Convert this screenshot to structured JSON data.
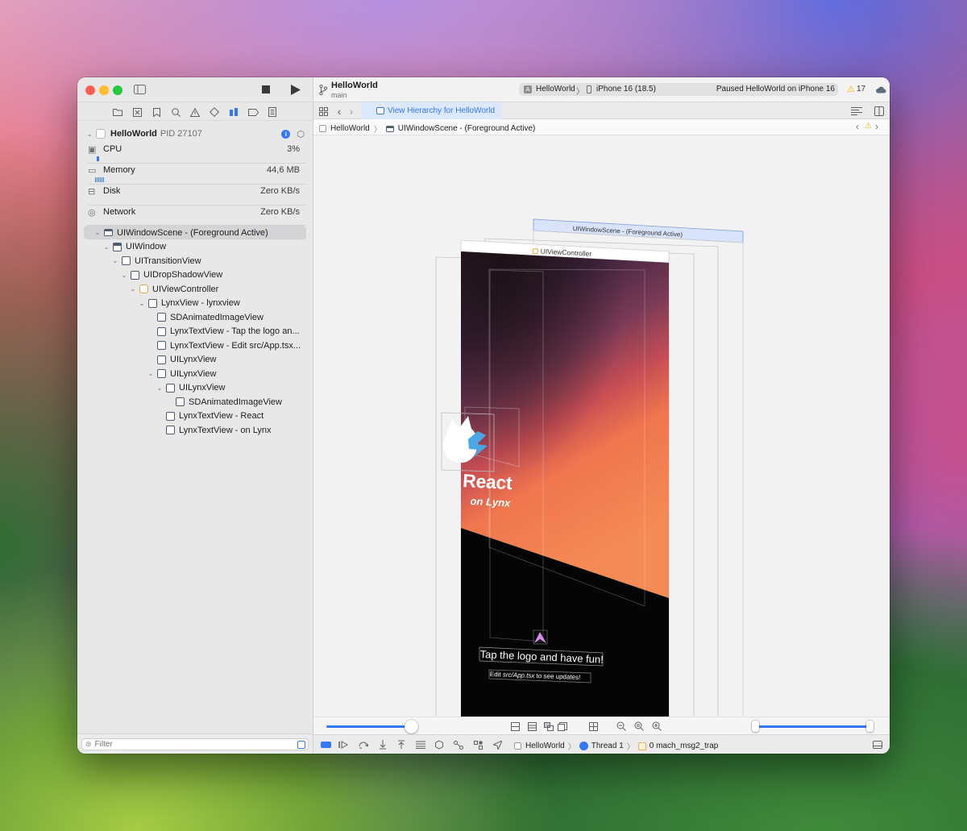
{
  "toolbar": {
    "project_title": "HelloWorld",
    "branch": "main",
    "scheme": "HelloWorld",
    "device": "iPhone 16 (18.5)",
    "status": "Paused HelloWorld on iPhone 16",
    "warning_count": "17"
  },
  "tab": {
    "label": "View Hierarchy for HelloWorld"
  },
  "breadcrumb": {
    "project": "HelloWorld",
    "scene": "UIWindowScene - (Foreground Active)"
  },
  "process": {
    "name": "HelloWorld",
    "pid": "PID 27107"
  },
  "gauges": [
    {
      "label": "CPU",
      "value": "3%"
    },
    {
      "label": "Memory",
      "value": "44,6 MB"
    },
    {
      "label": "Disk",
      "value": "Zero KB/s"
    },
    {
      "label": "Network",
      "value": "Zero KB/s"
    }
  ],
  "tree": [
    {
      "label": "UIWindowScene - (Foreground Active)"
    },
    {
      "label": "UIWindow"
    },
    {
      "label": "UITransitionView"
    },
    {
      "label": "UIDropShadowView"
    },
    {
      "label": "UIViewController"
    },
    {
      "label": "LynxView - lynxview"
    },
    {
      "label": "SDAnimatedImageView"
    },
    {
      "label": "LynxTextView - Tap the logo an..."
    },
    {
      "label": "LynxTextView - Edit src/App.tsx..."
    },
    {
      "label": "UILynxView"
    },
    {
      "label": "UILynxView"
    },
    {
      "label": "UILynxView"
    },
    {
      "label": "SDAnimatedImageView"
    },
    {
      "label": "LynxTextView - React"
    },
    {
      "label": "LynxTextView - on Lynx"
    }
  ],
  "filter": {
    "placeholder": "Filter"
  },
  "canvas": {
    "scene_label": "UIWindowScene - (Foreground Active)",
    "vc_label": "UIViewController",
    "react": "React",
    "on_lynx": "on Lynx",
    "tap_text": "Tap the logo and have fun!",
    "edit_prefix": "Edit ",
    "edit_file": "src/App.tsx",
    "edit_suffix": " to see updates!"
  },
  "debug_bar": {
    "project": "HelloWorld",
    "thread": "Thread 1",
    "frame": "0 mach_msg2_trap"
  },
  "colors": {
    "accent": "#3478f6",
    "vc_orange": "#e5a53a",
    "warning": "#f5b400"
  }
}
